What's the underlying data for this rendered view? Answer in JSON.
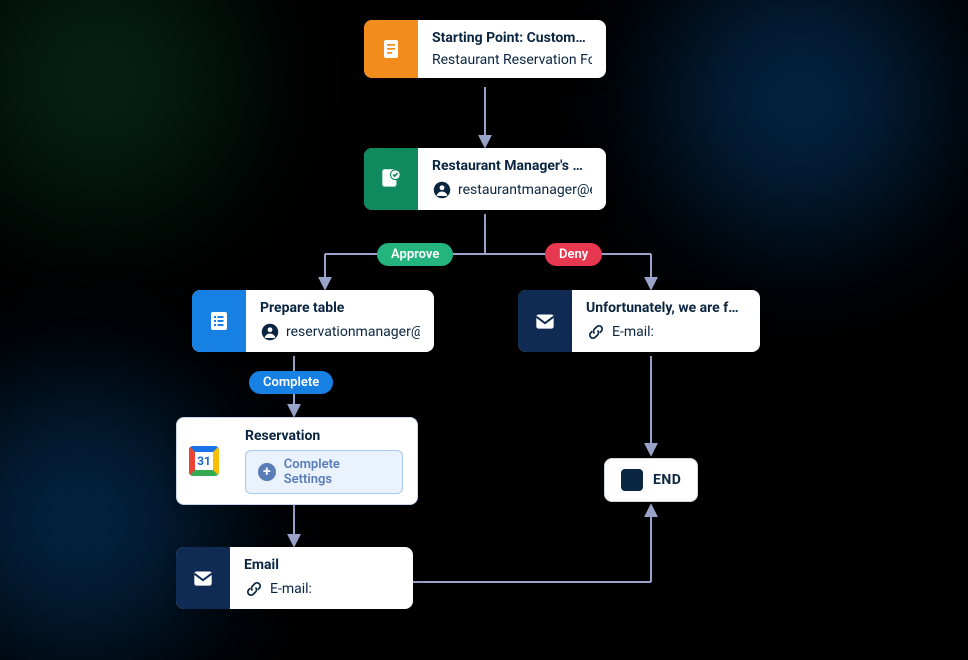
{
  "nodes": {
    "start": {
      "title": "Starting Point: Customer's R...",
      "subtitle": "Restaurant Reservation Fo...",
      "color": "#f28c1c"
    },
    "approval": {
      "title": "Restaurant Manager's Appro...",
      "assignee": "restaurantmanager@e...",
      "color": "#0f8a5f"
    },
    "prepare": {
      "title": "Prepare table",
      "assignee": "reservationmanager@...",
      "color": "#1780e3"
    },
    "full": {
      "title": "Unfortunately, we are full.",
      "link_label": "E-mail:",
      "color": "#0f2b54"
    },
    "reservation": {
      "title": "Reservation",
      "button": "Complete Settings",
      "calendar_day": "31"
    },
    "email": {
      "title": "Email",
      "link_label": "E-mail:",
      "color": "#0f2b54"
    },
    "end": {
      "label": "END"
    }
  },
  "badges": {
    "approve": "Approve",
    "deny": "Deny",
    "complete": "Complete"
  },
  "colors": {
    "approve": "#24b47e",
    "deny": "#e8384f",
    "complete": "#1780e3",
    "connector": "#9aa3c9"
  }
}
